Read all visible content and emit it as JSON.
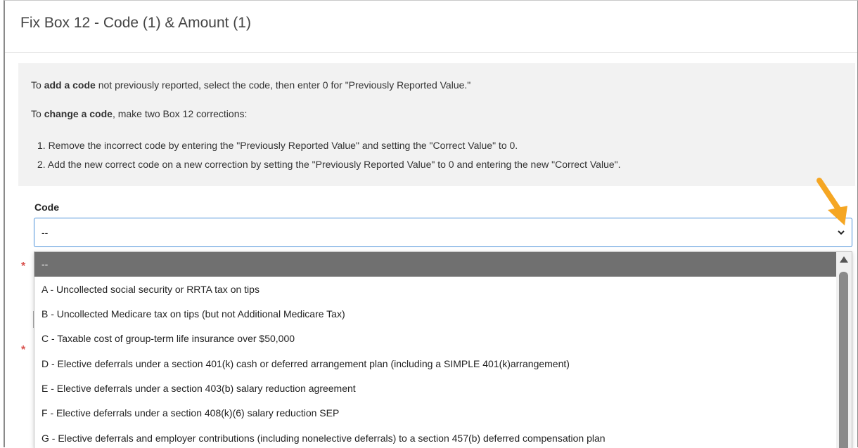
{
  "dialog": {
    "title": "Fix Box 12 - Code (1) & Amount (1)"
  },
  "info": {
    "line1_prefix": "To ",
    "line1_bold": "add a code",
    "line1_suffix": " not previously reported, select the code, then enter 0 for \"Previously Reported Value.\"",
    "line2_prefix": "To ",
    "line2_bold": "change a code",
    "line2_suffix": ", make two Box 12 corrections:",
    "step1": "1. Remove the incorrect code by entering the \"Previously Reported Value\" and setting the \"Correct Value\" to 0.",
    "step2": "2. Add the new correct code on a new correction by setting the \"Previously Reported Value\" to 0 and entering the new \"Correct Value\"."
  },
  "code_field": {
    "label": "Code",
    "selected_value": "--"
  },
  "required_marker": "*",
  "dropdown": {
    "options": [
      "--",
      "A - Uncollected social security or RRTA tax on tips",
      "B - Uncollected Medicare tax on tips (but not Additional Medicare Tax)",
      "C - Taxable cost of group-term life insurance over $50,000",
      "D - Elective deferrals under a section 401(k) cash or deferred arrangement plan (including a SIMPLE 401(k)arrangement)",
      "E - Elective deferrals under a section 403(b) salary reduction agreement",
      "F - Elective deferrals under a section 408(k)(6) salary reduction SEP",
      "G - Elective deferrals and employer contributions (including nonelective deferrals) to a section 457(b) deferred compensation plan"
    ],
    "highlighted_index": 0
  },
  "colors": {
    "accent_border": "#4a90d9",
    "highlight_bg": "#707070",
    "annotation_arrow": "#f5a623",
    "required": "#d9534f"
  },
  "icons": {
    "select_chevron": "chevron-down-icon",
    "annotation": "arrow-annotation-icon",
    "scroll_up": "scroll-up-arrow-icon"
  }
}
